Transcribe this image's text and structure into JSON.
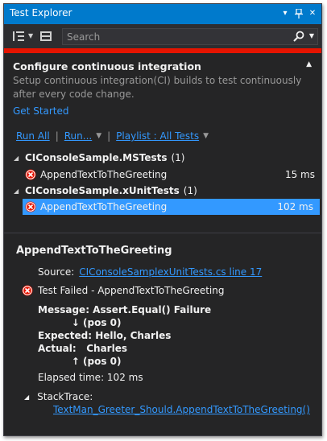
{
  "window": {
    "title": "Test Explorer",
    "buttons": [
      "▾",
      "▪",
      "✕"
    ]
  },
  "toolbar": {
    "search_placeholder": "Search"
  },
  "ci": {
    "title": "Configure continuous integration",
    "description": "Setup continuous integration(CI) builds to test continuously after every code change.",
    "link": "Get Started"
  },
  "filters": {
    "run_all": "Run All",
    "run": "Run...",
    "playlist": "Playlist : All Tests"
  },
  "groups": [
    {
      "name": "CIConsoleSample.MSTests",
      "count": "(1)",
      "tests": [
        {
          "name": "AppendTextToTheGreeting",
          "time": "15 ms",
          "status": "failed"
        }
      ]
    },
    {
      "name": "CIConsoleSample.xUnitTests",
      "count": "(1)",
      "tests": [
        {
          "name": "AppendTextToTheGreeting",
          "time": "102 ms",
          "status": "failed",
          "selected": true
        }
      ]
    }
  ],
  "detail": {
    "title": "AppendTextToTheGreeting",
    "source_label": "Source:",
    "source_link": "CIConsoleSamplexUnitTests.cs line 17",
    "failed_text": "Test Failed - AppendTextToTheGreeting",
    "message_line1": "Message: Assert.Equal() Failure",
    "message_line2": "          ↓ (pos 0)",
    "expected_line": "Expected: Hello, Charles",
    "actual_line": "Actual:   Charles",
    "message_line5": "          ↑ (pos 0)",
    "elapsed": "Elapsed time: 102 ms",
    "stacktrace_label": "StackTrace:",
    "stacktrace_link": "TextMan_Greeter_Should.AppendTextToTheGreeting()"
  },
  "colors": {
    "accent": "#007acc",
    "failure_bar": "#e51400",
    "selection": "#3399ff",
    "link": "#3399ff",
    "failed_icon": "#e51400"
  }
}
